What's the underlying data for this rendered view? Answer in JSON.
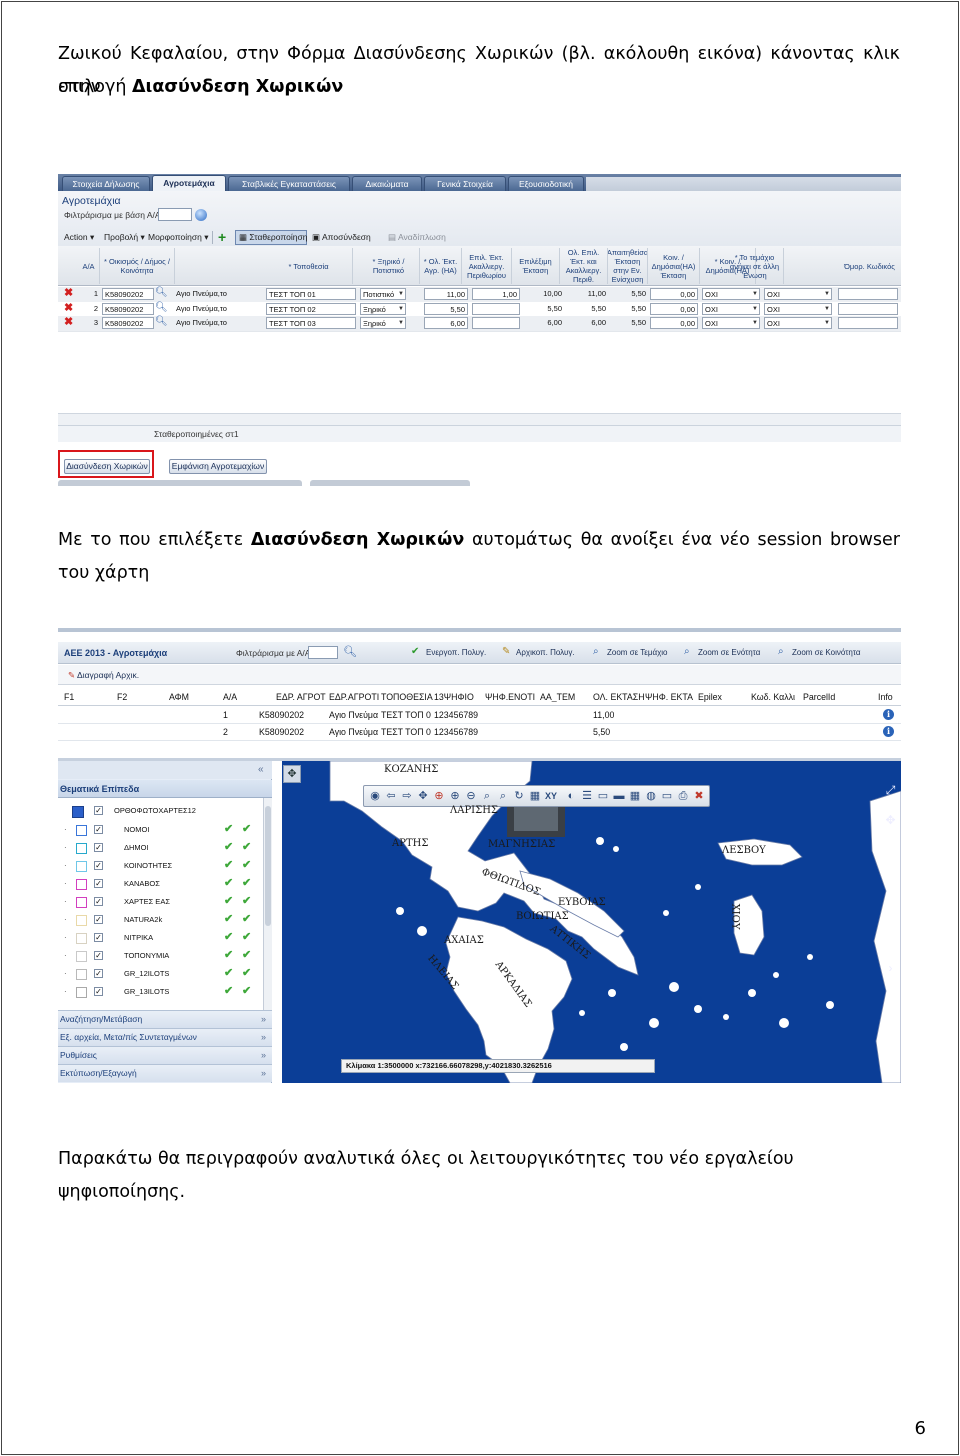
{
  "doc": {
    "intro_line1": "Ζωικού Κεφαλαίου, στην Φόρμα Διασύνδεσης Χωρικών (βλ. ακόλουθη εικόνα) κάνοντας κλικ στην",
    "intro_line2_prefix": "επιλογή ",
    "intro_line2_bold": "Διασύνδεση Χωρικών",
    "mid_prefix": "Με το που επιλέξετε ",
    "mid_bold": "Διασύνδεση Χωρικών",
    "mid_suffix": " αυτομάτως θα ανοίξει ένα νέο session browser",
    "mid_line2": "του χάρτη",
    "closing": "Παρακάτω θα περιγραφούν αναλυτικά όλες οι λειτουργικότητες του νέο εργαλείου ψηφιοποίησης.",
    "page_number": "6"
  },
  "screenshot1": {
    "tabs": [
      "Στοιχεία Δήλωσης",
      "Αγροτεμάχια",
      "Σταβλικές Εγκαταστάσεις",
      "Δικαιώματα",
      "Γενικά Στοιχεία",
      "Εξουσιοδοτική"
    ],
    "title": "Αγροτεμάχια",
    "filter_label": "Φιλτράρισμα με βάση Α/Α",
    "toolbar": {
      "action": "Action",
      "view": "Προβολή",
      "format": "Μορφοποίηση",
      "stab": "Σταθεροποίηση",
      "detach": "Αποσύνδεση",
      "wrap": "Αναδίπλωση"
    },
    "headers": [
      "Α/Α",
      "* Οικισμός / Δήμος / Κοινότητα",
      "* Τοποθεσία",
      "* Ξηρικό / Ποτιστικό",
      "* Ολ. Έκτ. Αγρ. (HA)",
      "Επιλ. Έκτ. Ακαλλιεργ. Περιθωρίου",
      "Επιλέξιμη Έκταση",
      "Ολ. Επιλ. Έκτ. και Ακαλλιεργ. Περιθ.",
      "Απαιτηθείσα Έκταση στην Εν. Ενίσχυση",
      "Κοιν. / Δημόσια(HA) Έκταση",
      "* Κοιν. / Δημόσια(HA)",
      "* Το τεμάχιο ανήκει σε άλλη Ένωση",
      "Όμορ. Κωδικός"
    ],
    "rows": [
      {
        "aa": "1",
        "code": "K58090202",
        "place": "Αγιο Πνεύμα,το",
        "loc": "ΤΕΣΤ ΤΟΠ 01",
        "type": "Ποτιστικό",
        "total": "11,00",
        "margin": "1,00",
        "elig": "10,00",
        "total2": "11,00",
        "req": "5,50",
        "pub": "0,00",
        "pub2": "ΟΧΙ",
        "other": "ΟΧΙ"
      },
      {
        "aa": "2",
        "code": "K58090202",
        "place": "Αγιο Πνεύμα,το",
        "loc": "ΤΕΣΤ ΤΟΠ 02",
        "type": "Ξηρικό",
        "total": "5,50",
        "margin": "",
        "elig": "5,50",
        "total2": "5,50",
        "req": "5,50",
        "pub": "0,00",
        "pub2": "ΟΧΙ",
        "other": "ΟΧΙ"
      },
      {
        "aa": "3",
        "code": "K58090202",
        "place": "Αγιο Πνεύμα,το",
        "loc": "ΤΕΣΤ ΤΟΠ 03",
        "type": "Ξηρικό",
        "total": "6,00",
        "margin": "",
        "elig": "6,00",
        "total2": "6,00",
        "req": "5,50",
        "pub": "0,00",
        "pub2": "ΟΧΙ",
        "other": "ΟΧΙ"
      }
    ],
    "status": "Σταθεροποιημένες στ1",
    "btn_link": "Διασύνδεση Χωρικών",
    "btn_show": "Εμφάνιση Αγροτεμαχίων"
  },
  "screenshot2": {
    "title": "ΑΕΕ 2013 - Αγροτεμάχια",
    "filter_label": "Φιλτράρισμα με Α/Α:",
    "tools": [
      "Ενεργοπ. Πολυγ.",
      "Αρχικοπ. Πολυγ.",
      "Zoom σε Τεμάχιο",
      "Zoom σε Ενότητα",
      "Zoom σε Κοινότητα"
    ],
    "delete_label": "Διαγραφή Αρχικ.",
    "headers": [
      "F1",
      "F2",
      "ΑΦΜ",
      "Α/Α",
      "ΕΔΡ. ΑΓΡΟΤ",
      "ΕΔΡ.ΑΓΡΟΤΙ",
      "ΤΟΠΟΘΕΣΙΑ",
      "13ΨΗΦΙΟ",
      "ΨΗΦ.ΕΝΟΤΙ",
      "ΑΑ_ΤΕΜ",
      "ΟΛ. ΕΚΤΑΣΗ",
      "ΨΗΦ. ΕΚΤΑ",
      "Epilex",
      "Κωδ. Καλλι",
      "ParcelId",
      "Info"
    ],
    "rows": [
      {
        "aa": "1",
        "edr": "K58090202",
        "edr2": "Αγιο Πνεύμα",
        "top": "ΤΕΣΤ ΤΟΠ 0",
        "code13": "123456789",
        "area": "11,00"
      },
      {
        "aa": "2",
        "edr": "K58090202",
        "edr2": "Αγιο Πνεύμα",
        "top": "ΤΕΣΤ ΤΟΠ 0",
        "code13": "123456789",
        "area": "5,50"
      }
    ],
    "panel_title": "Θεματικά Επίπεδα",
    "base_layer": "ΟΡΘΟΦΩΤΟΧΑΡΤΕΣ12",
    "layers": [
      {
        "name": "ΝΟΜΟΙ",
        "color": "#3a76d9"
      },
      {
        "name": "ΔΗΜΟΙ",
        "color": "#27a9cc"
      },
      {
        "name": "ΚΟΙΝΟΤΗΤΕΣ",
        "color": "#6fc7e8"
      },
      {
        "name": "ΚΑΝΑΒΟΣ",
        "color": "#d23fbf"
      },
      {
        "name": "ΧΑΡΤΕΣ ΕΑΣ",
        "color": "#d23fbf"
      },
      {
        "name": "NATURA2k",
        "color": "#e9d9a8"
      },
      {
        "name": "ΝΙΤΡΙΚΑ",
        "color": "#d8d2c2"
      },
      {
        "name": "ΤΟΠΟΝΥΜΙΑ",
        "color": "#c9c9c9"
      },
      {
        "name": "GR_12ILOTS",
        "color": "#b9b9b9"
      },
      {
        "name": "GR_13ILOTS",
        "color": "#a9a9a9"
      }
    ],
    "accordion": [
      "Αναζήτηση/Μετάβαση",
      "Εξ. αρχεία, Μετα/πίς Συντεταγμένων",
      "Ρυθμίσεις",
      "Εκτύπωση/Εξαγωγή"
    ],
    "map_labels": [
      "ΚΟΖΑΝΗΣ",
      "ΛΑΡΙΣΗΣ",
      "ΑΡΤΗΣ",
      "ΜΑΓΝΗΣΙΑΣ",
      "ΛΕΣΒΟΥ",
      "ΦΘΙΩΤΙΔΟΣ",
      "ΕΥΒΟΙΑΣ",
      "ΒΟΙΩΤΙΑΣ",
      "ΧΙΟΥ",
      "ΑΧΑΙΑΣ",
      "ΑΤΤΙΚΗΣ",
      "ΗΛΕΙΑΣ",
      "ΑΡΚΑΔΙΑΣ"
    ],
    "scale_text": "Κλίμακα 1:3500000 x:732166.66078298,y:4021830.3262516",
    "colors": {
      "sea": "#0b3e97",
      "land": "#ffffff"
    }
  }
}
